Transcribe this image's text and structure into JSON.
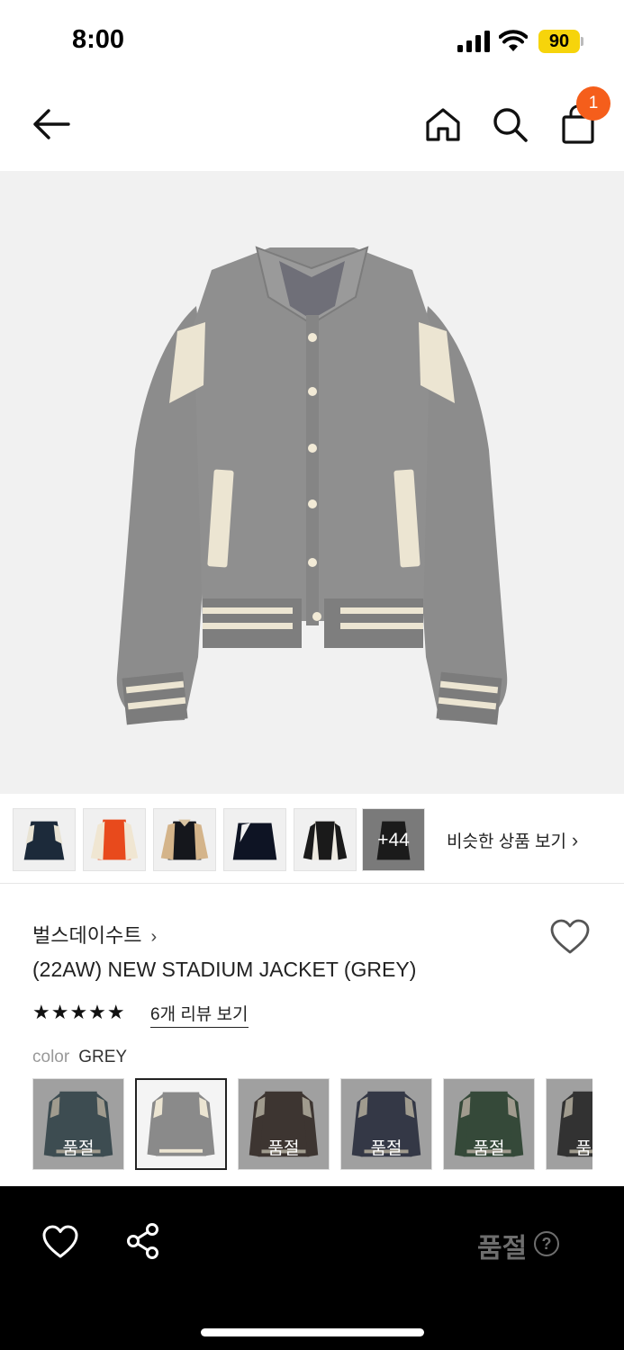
{
  "status_bar": {
    "time": "8:00",
    "battery": "90"
  },
  "header": {
    "back_icon": "arrow-left-icon",
    "home_icon": "home-icon",
    "search_icon": "search-icon",
    "bag_icon": "shopping-bag-icon",
    "cart_count": "1",
    "badge_color": "#f55e1b"
  },
  "thumbnails": {
    "more_count": "+44",
    "similar_label": "비슷한 상품 보기",
    "similar_chevron": "›"
  },
  "product": {
    "brand": "벌스데이수트",
    "brand_chevron": "›",
    "title": "(22AW) NEW STADIUM JACKET (GREY)",
    "stars": "★★★★★",
    "rating": 5,
    "review_link": "6개 리뷰 보기",
    "color_label": "color",
    "color_value": "GREY"
  },
  "swatches": [
    {
      "color": "#5b7178",
      "soldout": "품절",
      "selected": false
    },
    {
      "color": "#8a8a8a",
      "soldout": "",
      "selected": true
    },
    {
      "color": "#5a4e49",
      "soldout": "품절",
      "selected": false
    },
    {
      "color": "#4d5367",
      "soldout": "품절",
      "selected": false
    },
    {
      "color": "#4e6c55",
      "soldout": "품절",
      "selected": false
    },
    {
      "color": "#4a4a4a",
      "soldout": "품절",
      "selected": false
    }
  ],
  "bottom_bar": {
    "like_icon": "heart-icon",
    "share_icon": "share-icon",
    "soldout_label": "품절",
    "help_label": "?"
  },
  "colors": {
    "jacket_body": "#8b8b8b",
    "jacket_accent": "#ece5d2",
    "hero_bg": "#f1f1f1"
  }
}
